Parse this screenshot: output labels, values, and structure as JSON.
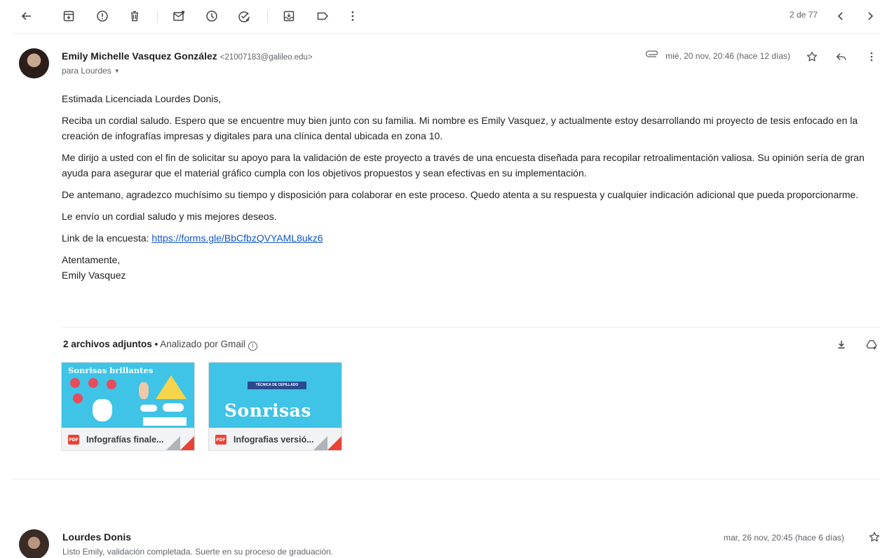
{
  "toolbar": {
    "pager": "2 de 77",
    "icons": [
      "back-arrow-icon",
      "archive-icon",
      "report-spam-icon",
      "delete-icon",
      "mark-unread-icon",
      "snooze-icon",
      "add-to-tasks-icon",
      "move-to-icon",
      "label-icon",
      "more-vert-icon",
      "chevron-left-icon",
      "chevron-right-icon"
    ]
  },
  "message1": {
    "sender_name": "Emily Michelle Vasquez González",
    "sender_email": "<21007183@galileo.edu>",
    "to_line": "para Lourdes",
    "date": "mié, 20 nov, 20:46 (hace 12 días)",
    "body": {
      "greeting": "Estimada Licenciada Lourdes Donis,",
      "p1": "Reciba un cordial saludo. Espero que se encuentre muy bien junto con su familia.  Mi nombre es Emily Vasquez, y actualmente estoy desarrollando mi proyecto de tesis enfocado en la creación de infografías impresas y digitales para una clínica dental ubicada en zona 10.",
      "p2": "Me dirijo a usted con el fin de solicitar su apoyo para la validación de este proyecto a través de una encuesta diseñada para recopilar retroalimentación valiosa. Su opinión sería de gran ayuda para asegurar que el material gráfico cumpla con los objetivos propuestos y sean efectivas en su implementación.",
      "p3": "De antemano, agradezco muchísimo su tiempo y disposición para colaborar en este proceso. Quedo atenta a su respuesta y cualquier indicación adicional que pueda proporcionarme.",
      "p4": "Le envío un cordial saludo y mis mejores deseos.",
      "link_label": "Link de la encuesta: ",
      "link_url": "https://forms.gle/BbCfbzQVYAML8ukz6",
      "closing": "Atentamente,",
      "signature": "Emily Vasquez"
    },
    "attachments": {
      "count_label": "2 archivos adjuntos",
      "separator": " • ",
      "scan_label": "Analizado por Gmail",
      "info_glyph": "i",
      "files": [
        {
          "name": "Infografías finale...",
          "type_badge": "PDF",
          "thumb_title": "Sonrisas brillantes"
        },
        {
          "name": "Infografias versió...",
          "type_badge": "PDF",
          "thumb_tag": "TÉCNICA DE CEPILLADO",
          "thumb_title": "Sonrisas"
        }
      ]
    }
  },
  "message2": {
    "sender_name": "Lourdes Donis",
    "snippet": "Listo Emily, validación completada. Suerte en su proceso de graduación.",
    "date": "mar, 26 nov, 20:45 (hace 6 días)"
  },
  "colors": {
    "link": "#1155cc",
    "thumb_background": "#3fc3e6",
    "pdf_red": "#ea4335"
  }
}
